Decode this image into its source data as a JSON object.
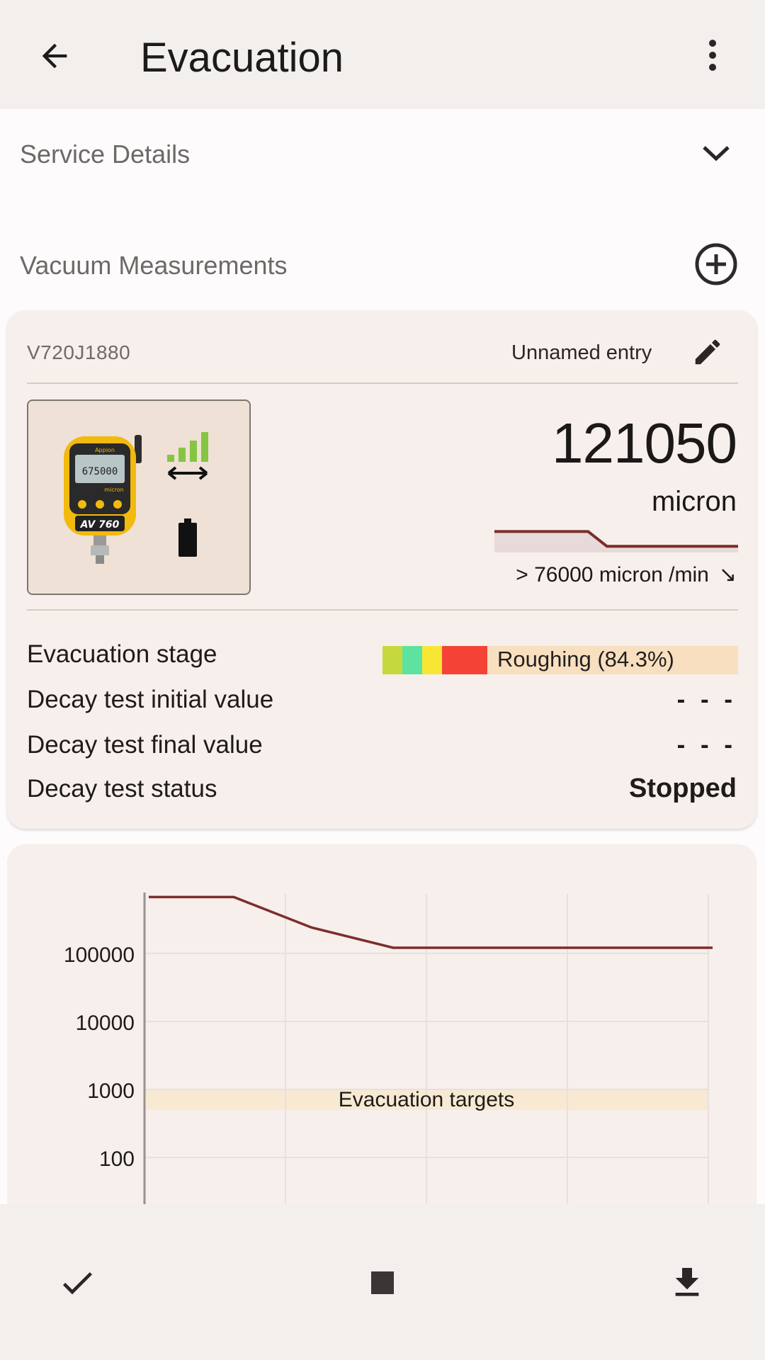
{
  "app_bar": {
    "title": "Evacuation",
    "back_icon": "arrow-back-icon",
    "menu_icon": "more-vertical-icon"
  },
  "service_details": {
    "label": "Service Details",
    "icon": "chevron-down-icon"
  },
  "vacuum": {
    "label": "Vacuum Measurements",
    "add_icon": "add-circle-icon"
  },
  "device": {
    "serial": "V720J1880",
    "entry_name": "Unnamed entry",
    "edit_icon": "edit-pencil-icon",
    "image_icon": "vacuum-gauge-device-icon",
    "signal_icon": "signal-bars-icon",
    "battery_icon": "battery-icon",
    "screen_reading": "675000",
    "screen_unit": "micron",
    "brand": "Appion",
    "model": "AV 760"
  },
  "measurement": {
    "value": "121050",
    "unit": "micron",
    "rate": "> 76000 micron /min",
    "trend_icon": "arrow-down-right-icon",
    "sparkline": [
      0.2,
      0.2,
      0.2,
      0.2,
      0.2,
      0.2,
      0.85,
      0.85,
      0.85,
      0.85,
      0.85,
      0.85,
      0.85,
      0.85
    ]
  },
  "details": {
    "stage_label": "Evacuation stage",
    "stage_value": "Roughing (84.3%)",
    "stage_colors": [
      "#c5d93f",
      "#5ee2a0",
      "#f7e634",
      "#f44336"
    ],
    "decay_initial_label": "Decay test initial value",
    "decay_initial_value": "- - -",
    "decay_final_label": "Decay test final value",
    "decay_final_value": "- - -",
    "decay_status_label": "Decay test status",
    "decay_status_value": "Stopped"
  },
  "chart_data": {
    "type": "line",
    "y_scale": "log",
    "y_ticks": [
      "100000",
      "10000",
      "1000",
      "100"
    ],
    "x": [
      0,
      1,
      2,
      3,
      4,
      5,
      6,
      7
    ],
    "series": [
      {
        "values": [
          675000,
          675000,
          240000,
          121050,
          121050,
          121050,
          121050,
          121050
        ],
        "color": "#7b2d2d"
      }
    ],
    "target_band_label": "Evacuation targets",
    "target_band": [
      500,
      1000
    ],
    "grid": true
  },
  "bottom_bar": {
    "check_icon": "check-icon",
    "stop_icon": "stop-square-icon",
    "download_icon": "download-icon"
  }
}
